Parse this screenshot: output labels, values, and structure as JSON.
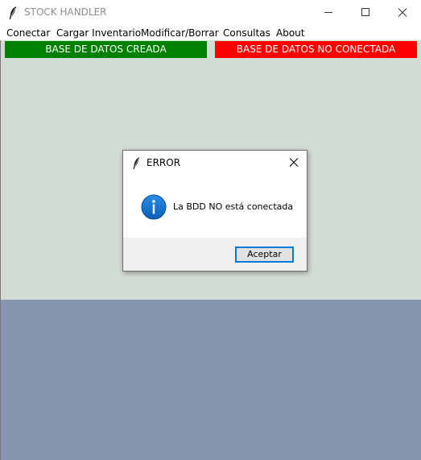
{
  "window": {
    "title": "STOCK HANDLER",
    "icon": "feather-icon"
  },
  "menubar": {
    "items": [
      {
        "label": "Conectar"
      },
      {
        "label": "Cargar Inventario"
      },
      {
        "label": "Modificar/Borrar"
      },
      {
        "label": "Consultas"
      },
      {
        "label": "About"
      }
    ]
  },
  "status": {
    "db_created": {
      "label": "BASE DE DATOS CREADA",
      "color": "#008000"
    },
    "db_connection": {
      "label": "BASE DE DATOS NO CONECTADA",
      "color": "#ff0000"
    }
  },
  "colors": {
    "client_top": "#d3dcd4",
    "client_bottom": "#8795b0",
    "accent": "#0078d7"
  },
  "dialog": {
    "title": "ERROR",
    "icon": "info-icon",
    "message": "La BDD NO está conectada",
    "button_label": "Aceptar"
  }
}
